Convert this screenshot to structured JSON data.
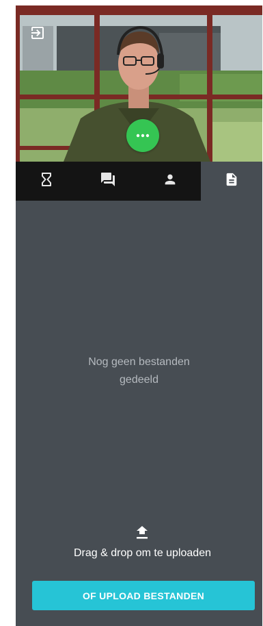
{
  "video": {
    "exit_icon": "exit-to-app-icon",
    "more_icon": "more-horizontal-icon",
    "more_button_color": "#35c553"
  },
  "tabs": [
    {
      "icon": "hourglass-icon",
      "active": false
    },
    {
      "icon": "chat-icon",
      "active": false
    },
    {
      "icon": "person-icon",
      "active": false
    },
    {
      "icon": "file-document-icon",
      "active": true
    }
  ],
  "files_panel": {
    "empty_text_line1": "Nog geen bestanden",
    "empty_text_line2": "gedeeld",
    "upload_icon": "upload-icon",
    "drag_drop_text": "Drag & drop om te uploaden",
    "upload_button_label": "OF UPLOAD BESTANDEN",
    "accent_color": "#26c4d6"
  }
}
